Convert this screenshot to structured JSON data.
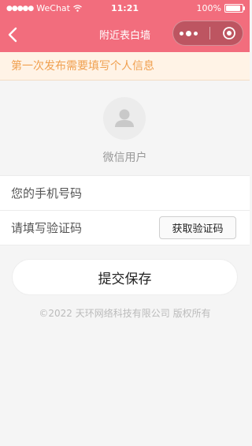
{
  "status_bar": {
    "signal": "●●●●●",
    "carrier": "WeChat",
    "time": "11:21",
    "battery": "100%",
    "battery_level": 1.0
  },
  "navbar": {
    "title": "附近表白墙",
    "back_icon": "chevron-left-icon",
    "menu_icon": "more-dots-icon",
    "close_icon": "target-circle-icon"
  },
  "notice": {
    "text": "第一次发布需要填写个人信息"
  },
  "profile": {
    "avatar_icon": "user-avatar-icon",
    "username": "微信用户"
  },
  "form": {
    "phone_placeholder": "您的手机号码",
    "code_placeholder": "请填写验证码",
    "get_code_label": "获取验证码"
  },
  "submit_label": "提交保存",
  "footer": "©2022 天环网络科技有限公司 版权所有",
  "colors": {
    "brand": "#f26d7d",
    "notice_text": "#f0a050",
    "notice_bg": "#fff3e6"
  }
}
